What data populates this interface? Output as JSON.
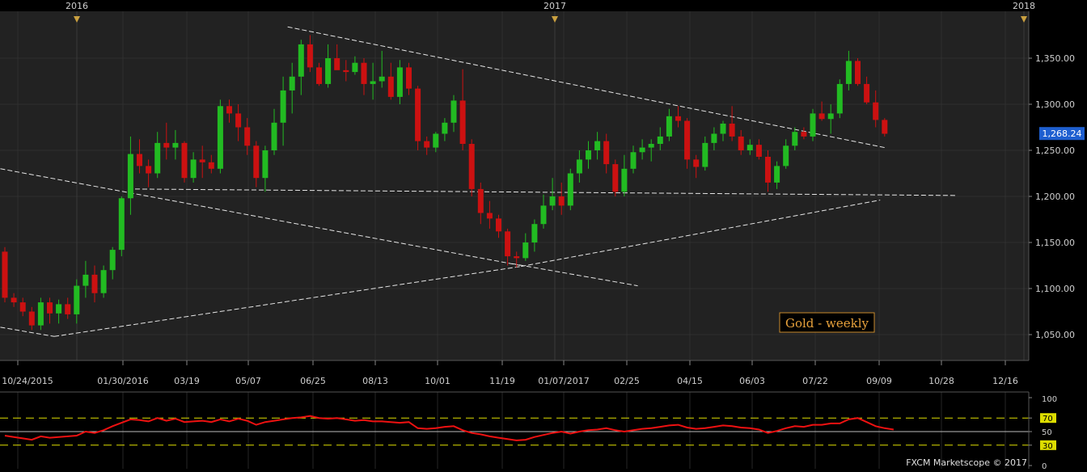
{
  "footer": "FXCM Marketscope © 2017",
  "annotation": "Gold - weekly",
  "colors": {
    "background": "#000000",
    "panel": "#222222",
    "grid": "#2f2f2f",
    "up": "#22bb22",
    "down": "#cc1111",
    "trendline": "#e6e6e6",
    "annotation_text": "#e8a23c",
    "annotation_border": "#c98a2c",
    "price_tag": "#1e5fd0",
    "axis_text": "#cfcfcf",
    "rsi_line": "#ee1111",
    "rsi_levels": "#dddd00",
    "year_marker": "#c9a040"
  },
  "chart_data": [
    {
      "type": "candlestick",
      "title": "Gold - weekly",
      "ylim": [
        1025,
        1390
      ],
      "y_ticks": [
        1050,
        1100,
        1150,
        1200,
        1250,
        1300,
        1350
      ],
      "y_tick_labels": [
        "1,050.00",
        "1,100.00",
        "1,150.00",
        "1,200.00",
        "1,250.00",
        "1,300.00",
        "1,350.00"
      ],
      "x_tick_labels": [
        "10/24/2015",
        "01/30/2016",
        "03/19",
        "05/07",
        "06/25",
        "08/13",
        "10/01",
        "11/19",
        "01/07/2017",
        "02/25",
        "04/15",
        "06/03",
        "07/22",
        "09/09",
        "10/28",
        "12/16"
      ],
      "year_markers": [
        "2016",
        "2017",
        "2018"
      ],
      "last_price": "1,268.24",
      "grid": true,
      "candles": [
        [
          1140,
          1145,
          1085,
          1090
        ],
        [
          1090,
          1095,
          1080,
          1085
        ],
        [
          1085,
          1090,
          1070,
          1075
        ],
        [
          1075,
          1080,
          1055,
          1060
        ],
        [
          1060,
          1090,
          1055,
          1085
        ],
        [
          1085,
          1090,
          1062,
          1073
        ],
        [
          1073,
          1088,
          1062,
          1083
        ],
        [
          1083,
          1090,
          1067,
          1072
        ],
        [
          1072,
          1110,
          1062,
          1103
        ],
        [
          1103,
          1130,
          1090,
          1115
        ],
        [
          1115,
          1125,
          1085,
          1095
        ],
        [
          1095,
          1125,
          1090,
          1120
        ],
        [
          1120,
          1145,
          1110,
          1142
        ],
        [
          1142,
          1200,
          1135,
          1198
        ],
        [
          1198,
          1265,
          1180,
          1246
        ],
        [
          1246,
          1262,
          1225,
          1233
        ],
        [
          1233,
          1240,
          1210,
          1225
        ],
        [
          1225,
          1270,
          1220,
          1258
        ],
        [
          1258,
          1280,
          1240,
          1253
        ],
        [
          1253,
          1272,
          1240,
          1258
        ],
        [
          1258,
          1260,
          1215,
          1220
        ],
        [
          1220,
          1248,
          1215,
          1240
        ],
        [
          1240,
          1255,
          1220,
          1237
        ],
        [
          1237,
          1245,
          1225,
          1230
        ],
        [
          1230,
          1305,
          1225,
          1298
        ],
        [
          1298,
          1305,
          1280,
          1290
        ],
        [
          1290,
          1300,
          1260,
          1275
        ],
        [
          1275,
          1285,
          1245,
          1255
        ],
        [
          1255,
          1260,
          1210,
          1220
        ],
        [
          1220,
          1255,
          1205,
          1250
        ],
        [
          1250,
          1295,
          1245,
          1280
        ],
        [
          1280,
          1330,
          1255,
          1315
        ],
        [
          1315,
          1345,
          1290,
          1330
        ],
        [
          1330,
          1370,
          1310,
          1365
        ],
        [
          1365,
          1375,
          1335,
          1340
        ],
        [
          1340,
          1345,
          1320,
          1322
        ],
        [
          1322,
          1365,
          1318,
          1350
        ],
        [
          1350,
          1365,
          1340,
          1337
        ],
        [
          1337,
          1348,
          1325,
          1335
        ],
        [
          1335,
          1352,
          1332,
          1345
        ],
        [
          1345,
          1350,
          1310,
          1322
        ],
        [
          1322,
          1345,
          1305,
          1325
        ],
        [
          1325,
          1358,
          1318,
          1330
        ],
        [
          1330,
          1345,
          1305,
          1308
        ],
        [
          1308,
          1348,
          1300,
          1340
        ],
        [
          1340,
          1345,
          1310,
          1317
        ],
        [
          1317,
          1320,
          1250,
          1260
        ],
        [
          1260,
          1265,
          1245,
          1253
        ],
        [
          1253,
          1270,
          1248,
          1268
        ],
        [
          1268,
          1285,
          1260,
          1280
        ],
        [
          1280,
          1310,
          1270,
          1304
        ],
        [
          1304,
          1338,
          1250,
          1257
        ],
        [
          1257,
          1262,
          1200,
          1208
        ],
        [
          1208,
          1215,
          1170,
          1182
        ],
        [
          1182,
          1195,
          1165,
          1176
        ],
        [
          1176,
          1180,
          1155,
          1162
        ],
        [
          1162,
          1165,
          1125,
          1135
        ],
        [
          1135,
          1140,
          1123,
          1133
        ],
        [
          1133,
          1160,
          1130,
          1150
        ],
        [
          1150,
          1175,
          1140,
          1170
        ],
        [
          1170,
          1202,
          1165,
          1190
        ],
        [
          1190,
          1220,
          1185,
          1200
        ],
        [
          1200,
          1215,
          1180,
          1190
        ],
        [
          1190,
          1230,
          1185,
          1225
        ],
        [
          1225,
          1250,
          1215,
          1240
        ],
        [
          1240,
          1260,
          1230,
          1250
        ],
        [
          1250,
          1270,
          1240,
          1260
        ],
        [
          1260,
          1268,
          1225,
          1235
        ],
        [
          1235,
          1240,
          1200,
          1205
        ],
        [
          1205,
          1245,
          1200,
          1230
        ],
        [
          1230,
          1255,
          1225,
          1248
        ],
        [
          1248,
          1262,
          1240,
          1253
        ],
        [
          1253,
          1262,
          1238,
          1257
        ],
        [
          1257,
          1275,
          1250,
          1265
        ],
        [
          1265,
          1295,
          1260,
          1287
        ],
        [
          1287,
          1298,
          1275,
          1282
        ],
        [
          1282,
          1285,
          1230,
          1240
        ],
        [
          1240,
          1245,
          1220,
          1232
        ],
        [
          1232,
          1265,
          1228,
          1258
        ],
        [
          1258,
          1275,
          1250,
          1268
        ],
        [
          1268,
          1282,
          1260,
          1279
        ],
        [
          1279,
          1298,
          1260,
          1265
        ],
        [
          1265,
          1272,
          1245,
          1250
        ],
        [
          1250,
          1262,
          1245,
          1256
        ],
        [
          1256,
          1262,
          1240,
          1243
        ],
        [
          1243,
          1250,
          1205,
          1215
        ],
        [
          1215,
          1238,
          1208,
          1233
        ],
        [
          1233,
          1262,
          1230,
          1255
        ],
        [
          1255,
          1275,
          1250,
          1270
        ],
        [
          1270,
          1275,
          1262,
          1265
        ],
        [
          1265,
          1295,
          1260,
          1290
        ],
        [
          1290,
          1303,
          1282,
          1284
        ],
        [
          1284,
          1300,
          1268,
          1290
        ],
        [
          1290,
          1327,
          1285,
          1322
        ],
        [
          1322,
          1358,
          1315,
          1347
        ],
        [
          1347,
          1350,
          1320,
          1322
        ],
        [
          1322,
          1330,
          1300,
          1302
        ],
        [
          1302,
          1315,
          1275,
          1283
        ],
        [
          1283,
          1285,
          1265,
          1268
        ]
      ],
      "trendlines": [
        {
          "from": [
            -0.5,
            1230
          ],
          "to": [
            57.5,
            1125
          ]
        },
        {
          "from": [
            56.5,
            1127
          ],
          "to": [
            70.5,
            1103
          ]
        },
        {
          "from": [
            -0.5,
            1058
          ],
          "to": [
            5.5,
            1048
          ]
        },
        {
          "from": [
            5.5,
            1048
          ],
          "to": [
            57.5,
            1124
          ]
        },
        {
          "from": [
            57.5,
            1124
          ],
          "to": [
            97.5,
            1196
          ]
        },
        {
          "from": [
            14.5,
            1208
          ],
          "to": [
            106,
            1201
          ]
        },
        {
          "from": [
            31.5,
            1384
          ],
          "to": [
            98,
            1253
          ]
        }
      ]
    },
    {
      "type": "line",
      "ylim": [
        0,
        100
      ],
      "levels": [
        30,
        50,
        70
      ],
      "y_tick_labels": [
        "100",
        "70",
        "50",
        "30",
        "0"
      ],
      "series": [
        {
          "values": [
            44,
            42,
            40,
            38,
            43,
            41,
            42,
            43,
            44,
            50,
            48,
            52,
            58,
            63,
            68,
            67,
            65,
            70,
            66,
            69,
            64,
            65,
            66,
            64,
            68,
            65,
            69,
            66,
            60,
            64,
            66,
            68,
            70,
            71,
            73,
            70,
            69,
            70,
            68,
            66,
            67,
            65,
            65,
            64,
            63,
            64,
            55,
            54,
            55,
            57,
            58,
            52,
            48,
            46,
            43,
            41,
            39,
            37,
            38,
            42,
            45,
            48,
            50,
            47,
            50,
            52,
            53,
            55,
            52,
            50,
            52,
            54,
            55,
            57,
            59,
            60,
            56,
            54,
            55,
            57,
            59,
            58,
            56,
            55,
            53,
            48,
            51,
            55,
            58,
            57,
            60,
            60,
            62,
            62,
            68,
            70,
            64,
            58,
            55,
            53
          ]
        }
      ]
    }
  ]
}
